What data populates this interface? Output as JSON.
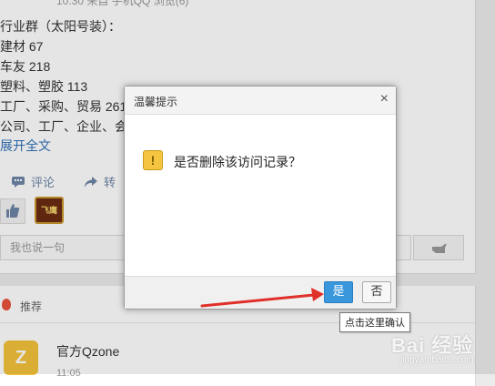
{
  "feed": {
    "meta": "10:30  来自 手机QQ  浏览(6)",
    "lines": [
      "行业群（太阳号装）：",
      "建材 67",
      "车友 218",
      "塑料、塑胶 113",
      "工厂、采购、贸易 261",
      "公司、工厂、企业、会"
    ],
    "expand": "展开全文",
    "actions": {
      "comment": "评论",
      "forward": "转"
    },
    "like_avatar_text": "飞鹰",
    "comment_placeholder": "我也说一句"
  },
  "recommend": {
    "title": "推荐",
    "avatar_letter": "Z",
    "name": "官方Qzone",
    "time": "11:05"
  },
  "dialog": {
    "title": "温馨提示",
    "close": "×",
    "icon_symbol": "!",
    "message": "是否删除该访问记录？",
    "yes": "是",
    "no": "否"
  },
  "tooltip": "点击这里确认",
  "watermark": {
    "main": "Bai 经验",
    "sub": "jingyan.baidu.com"
  },
  "colors": {
    "primary_button": "#3a97dc",
    "arrow": "#e0302a",
    "link": "#2e6fb7"
  }
}
